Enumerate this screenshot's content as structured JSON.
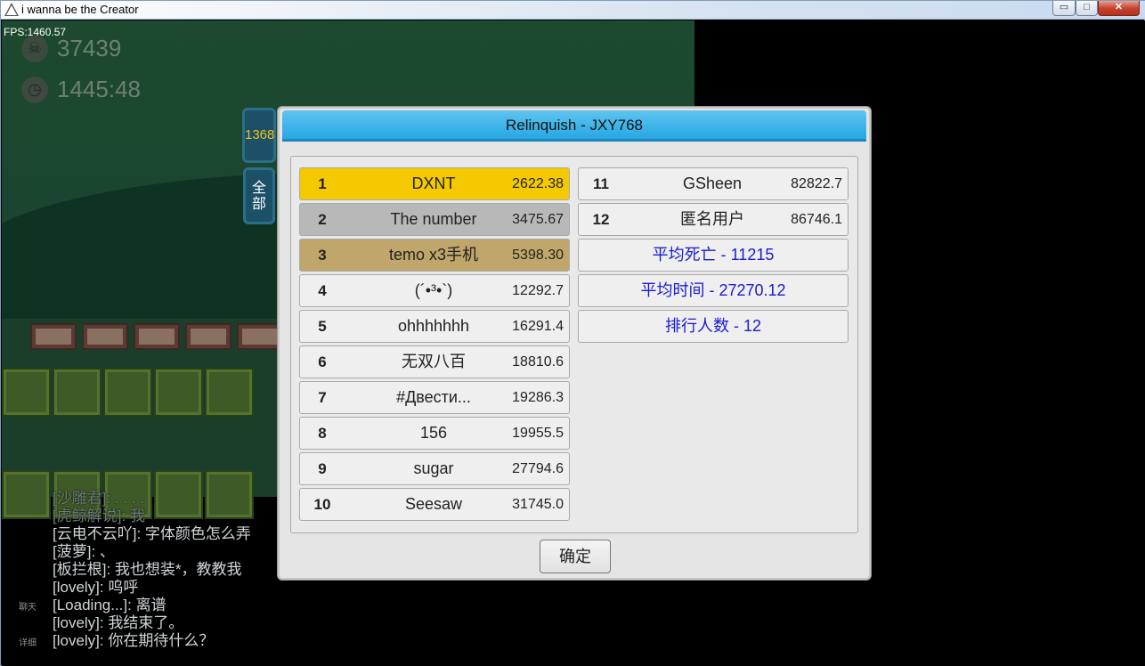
{
  "window": {
    "title": "i wanna be the Creator",
    "minimize_glyph": "▭",
    "maximize_glyph": "□",
    "close_glyph": "✕"
  },
  "game": {
    "fps": "FPS:1460.57",
    "deaths": "37439",
    "time": "1445:48",
    "death_icon": "skull-icon",
    "time_icon": "clock-icon"
  },
  "side": {
    "count": "1368",
    "all_label_line1": "全",
    "all_label_line2": "部"
  },
  "dialog": {
    "title": "Relinquish - JXY768",
    "ok_label": "确定",
    "left_rows": [
      {
        "rank": "1",
        "name": "DXNT",
        "score": "2622.38"
      },
      {
        "rank": "2",
        "name": "The number",
        "score": "3475.67"
      },
      {
        "rank": "3",
        "name": "temo x3手机",
        "score": "5398.30"
      },
      {
        "rank": "4",
        "name": "(´•³•`)",
        "score": "12292.7"
      },
      {
        "rank": "5",
        "name": "ohhhhhhh",
        "score": "16291.4"
      },
      {
        "rank": "6",
        "name": "无双八百",
        "score": "18810.6"
      },
      {
        "rank": "7",
        "name": "#Двести...",
        "score": "19286.3"
      },
      {
        "rank": "8",
        "name": "156",
        "score": "19955.5"
      },
      {
        "rank": "9",
        "name": "sugar",
        "score": "27794.6"
      },
      {
        "rank": "10",
        "name": "Seesaw",
        "score": "31745.0"
      }
    ],
    "right_rows": [
      {
        "rank": "11",
        "name": "GSheen",
        "score": "82822.7"
      },
      {
        "rank": "12",
        "name": "匿名用户",
        "score": "86746.1"
      }
    ],
    "stats": {
      "avg_deaths": "平均死亡 - 11215",
      "avg_time": "平均时间 - 27270.12",
      "count": "排行人数 - 12"
    },
    "colors": {
      "gold": "#f4c900",
      "silver": "#b8b8b8",
      "bronze": "#c0a66a",
      "stat_text": "#1a1ad6",
      "header": "#26a7e3"
    }
  },
  "chat": {
    "lines": [
      "[沙雕君]: . . . .",
      "[虎鲸解说]: 我",
      "[云电不云吖]: 字体颜色怎么弄",
      "[菠萝]: 、",
      "[板拦根]: 我也想装*，教教我",
      "[lovely]: 呜呼",
      "[Loading...]: 离谱",
      "[lovely]: 我结束了。",
      "[lovely]: 你在期待什么？"
    ],
    "tab_chat": "聊天",
    "tab_detail": "详细"
  }
}
